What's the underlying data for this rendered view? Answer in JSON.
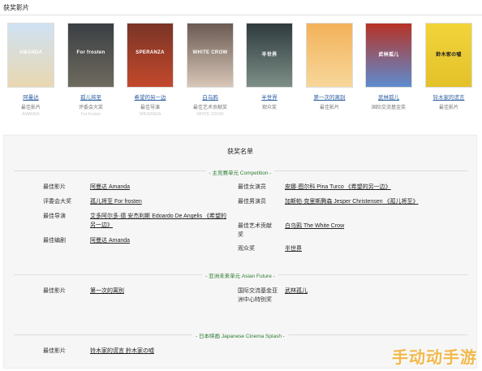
{
  "page_title": "获奖影片",
  "films": [
    {
      "title": "阿曼达",
      "award": "最佳影片",
      "sub": "AMANDA",
      "poster_text": "AMANDA",
      "poster_colors": [
        "#cfe2f3",
        "#e9d7b0"
      ]
    },
    {
      "title": "孤儿将至",
      "award": "评委会大奖",
      "sub": "For frosten",
      "poster_text": "For frosten",
      "poster_colors": [
        "#3b3f44",
        "#6e6a5e"
      ]
    },
    {
      "title": "希望的另一边",
      "award": "最佳导演",
      "sub": "SPERANZA",
      "poster_text": "SPERANZA",
      "poster_colors": [
        "#7a3426",
        "#c3492c"
      ]
    },
    {
      "title": "白乌鸦",
      "award": "最佳艺术贡献奖",
      "sub": "WHITE CROW",
      "poster_text": "WHITE CROW",
      "poster_colors": [
        "#6a5a52",
        "#d8c7b8"
      ]
    },
    {
      "title": "半世界",
      "award": "观众奖",
      "sub": "",
      "poster_text": "半世界",
      "poster_colors": [
        "#2e3a3d",
        "#7d8f87"
      ]
    },
    {
      "title": "第一次的离别",
      "award": "最佳影片",
      "sub": "",
      "poster_text": "",
      "poster_colors": [
        "#f3b25a",
        "#f7d79a"
      ]
    },
    {
      "title": "武林孤儿",
      "award": "国际交流基金奖",
      "sub": "",
      "poster_text": "武林孤儿",
      "poster_colors": [
        "#b73226",
        "#5d8ccf"
      ]
    },
    {
      "title": "铃木家的谎言",
      "award": "最佳影片",
      "sub": "",
      "poster_text": "鈴木家の嘘",
      "poster_colors": [
        "#f2d43a",
        "#e3c12a"
      ]
    }
  ],
  "panel": {
    "title": "获奖名单",
    "sections": [
      {
        "label": "- 主竞赛单元 Competition -"
      },
      {
        "label": "- 亚洲未来单元 Asian Future -"
      },
      {
        "label": "- 日本映画 Japanese Cinema Splash -"
      }
    ],
    "competition_left": [
      {
        "key": "最佳影片",
        "value": "阿曼达 Amanda"
      },
      {
        "key": "评委会大奖",
        "value": "孤儿将至 For frosten"
      },
      {
        "key": "最佳导演",
        "value": "艾多阿尔多·德 安杰利斯 Edoardo De Angelis 《希望的另一边》"
      },
      {
        "key": "最佳编剧",
        "value": "阿曼达 Amanda"
      }
    ],
    "competition_right": [
      {
        "key": "最佳女演员",
        "value": "皮娜·图尔科 Pina Turco 《希望的另一边》"
      },
      {
        "key": "最佳男演员",
        "value": "加斯帕·克里斯腾森 Jesper Christensen 《孤儿将至》"
      },
      {
        "key": "最佳艺术贡献奖",
        "value": "白乌鸦 The White Crow"
      },
      {
        "key": "观众奖",
        "value": "半世界"
      }
    ],
    "asian_left": [
      {
        "key": "最佳影片",
        "value": "第一次的离别"
      }
    ],
    "asian_right": [
      {
        "key": "国际交流基金亚洲中心特别奖",
        "value": "武林孤儿"
      }
    ],
    "japan_left": [
      {
        "key": "最佳影片",
        "value": "铃木家的谎言 鈴木家の嘘"
      }
    ]
  },
  "watermark": "手动动手游"
}
